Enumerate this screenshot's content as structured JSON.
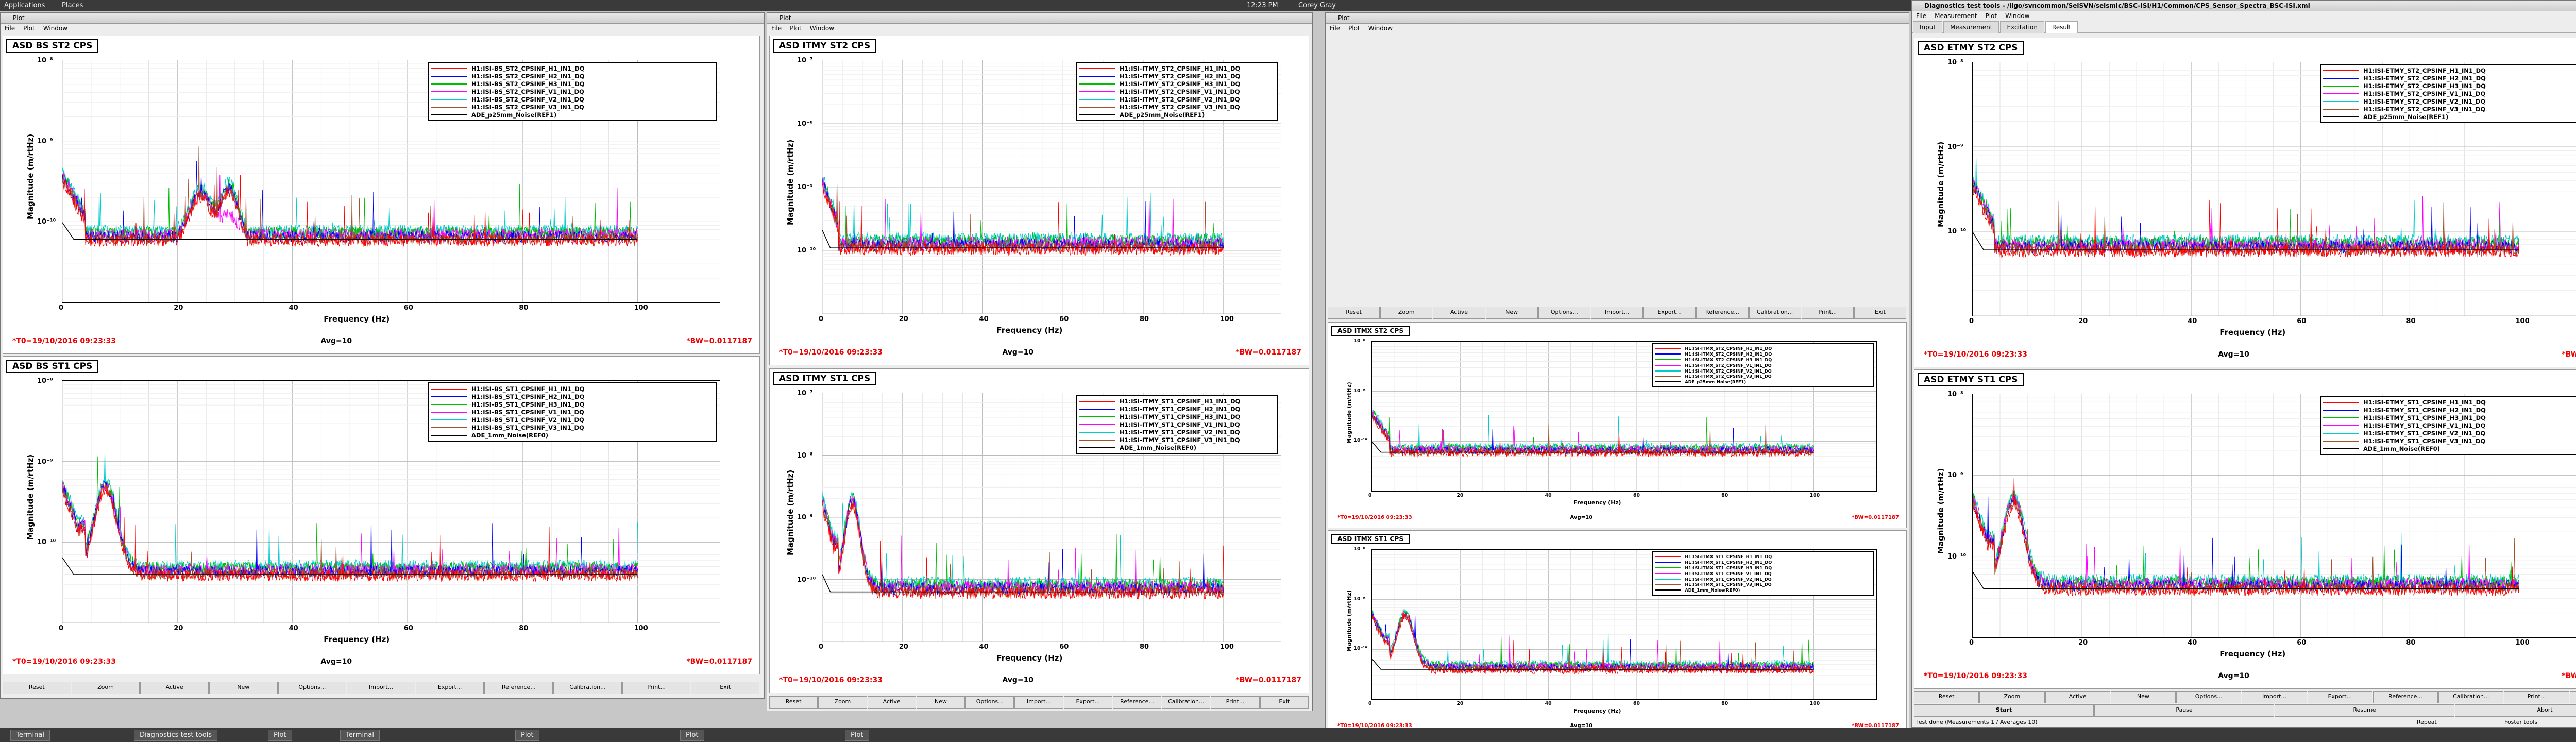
{
  "topbar": {
    "applications": "Applications",
    "places": "Places",
    "clock": "12:23 PM",
    "user": "Corey Gray"
  },
  "taskbar": {
    "tasks": [
      "Terminal",
      "Diagnostics test tools",
      "Plot",
      "Terminal",
      "Plot",
      "Plot",
      "Plot"
    ]
  },
  "windows": {
    "plot1": {
      "title": "Plot",
      "menus": [
        "File",
        "Plot",
        "Window"
      ]
    },
    "plot2": {
      "title": "Plot",
      "menus": [
        "File",
        "Plot",
        "Window"
      ]
    },
    "plot3": {
      "title": "Plot",
      "menus": [
        "File",
        "Plot",
        "Window"
      ]
    },
    "diag": {
      "title": "Diagnostics test tools - /ligo/svncommon/SeiSVN/seismic/BSC-ISI/H1/Common/CPS_Sensor_Spectra_BSC-ISI.xml",
      "menus": [
        "File",
        "Measurement",
        "Plot",
        "Window"
      ],
      "tabs": [
        "Input",
        "Measurement",
        "Excitation",
        "Result"
      ],
      "start": "Start",
      "pause": "Pause",
      "resume": "Resume",
      "abort": "Abort",
      "status_left": "Test done (Measurements 1 / Averages 10)",
      "status_mid": "Repeat",
      "status_right": "Foster tools"
    }
  },
  "buttons": [
    "Reset",
    "Zoom",
    "Active",
    "New",
    "Options...",
    "Import...",
    "Export...",
    "Reference...",
    "Calibration...",
    "Print...",
    "Exit"
  ],
  "common": {
    "ylabel": "Magnitude (m/rtHz)",
    "xlabel": "Frequency (Hz)",
    "t0": "*T0=19/10/2016 09:23:33",
    "avg": "Avg=10",
    "bw": "*BW=0.0117187",
    "xticks": [
      "0",
      "20",
      "40",
      "60",
      "80",
      "100"
    ],
    "yticks3": [
      "10⁻⁸",
      "10⁻⁹",
      "10⁻¹⁰"
    ],
    "yticks2": [
      "10⁻⁹",
      "10⁻¹⁰"
    ],
    "yticks4": [
      "10⁻⁷",
      "10⁻⁸",
      "10⁻⁹",
      "10⁻¹⁰"
    ]
  },
  "colors": {
    "H1": "#ff0000",
    "H2": "#0000ff",
    "H3": "#00bb00",
    "V1": "#ff00ff",
    "V2": "#00cccc",
    "V3": "#a0522d",
    "REF": "#000000"
  },
  "panels": [
    {
      "title": "ASD BS ST2 CPS",
      "legend": [
        "H1:ISI-BS_ST2_CPSINF_H1_IN1_DQ",
        "H1:ISI-BS_ST2_CPSINF_H2_IN1_DQ",
        "H1:ISI-BS_ST2_CPSINF_H3_IN1_DQ",
        "H1:ISI-BS_ST2_CPSINF_V1_IN1_DQ",
        "H1:ISI-BS_ST2_CPSINF_V2_IN1_DQ",
        "H1:ISI-BS_ST2_CPSINF_V3_IN1_DQ",
        "ADE_p25mm_Noise(REF1)"
      ]
    },
    {
      "title": "ASD BS ST1 CPS",
      "legend": [
        "H1:ISI-BS_ST1_CPSINF_H1_IN1_DQ",
        "H1:ISI-BS_ST1_CPSINF_H2_IN1_DQ",
        "H1:ISI-BS_ST1_CPSINF_H3_IN1_DQ",
        "H1:ISI-BS_ST1_CPSINF_V1_IN1_DQ",
        "H1:ISI-BS_ST1_CPSINF_V2_IN1_DQ",
        "H1:ISI-BS_ST1_CPSINF_V3_IN1_DQ",
        "ADE_1mm_Noise(REF0)"
      ]
    },
    {
      "title": "ASD ITMY ST2 CPS",
      "legend": [
        "H1:ISI-ITMY_ST2_CPSINF_H1_IN1_DQ",
        "H1:ISI-ITMY_ST2_CPSINF_H2_IN1_DQ",
        "H1:ISI-ITMY_ST2_CPSINF_H3_IN1_DQ",
        "H1:ISI-ITMY_ST2_CPSINF_V1_IN1_DQ",
        "H1:ISI-ITMY_ST2_CPSINF_V2_IN1_DQ",
        "H1:ISI-ITMY_ST2_CPSINF_V3_IN1_DQ",
        "ADE_p25mm_Noise(REF1)"
      ]
    },
    {
      "title": "ASD ITMY ST1 CPS",
      "legend": [
        "H1:ISI-ITMY_ST1_CPSINF_H1_IN1_DQ",
        "H1:ISI-ITMY_ST1_CPSINF_H2_IN1_DQ",
        "H1:ISI-ITMY_ST1_CPSINF_H3_IN1_DQ",
        "H1:ISI-ITMY_ST1_CPSINF_V1_IN1_DQ",
        "H1:ISI-ITMY_ST1_CPSINF_V2_IN1_DQ",
        "H1:ISI-ITMY_ST1_CPSINF_V3_IN1_DQ",
        "ADE_1mm_Noise(REF0)"
      ]
    },
    {
      "title": "ASD ITMX ST2 CPS",
      "legend": [
        "H1:ISI-ITMX_ST2_CPSINF_H1_IN1_DQ",
        "H1:ISI-ITMX_ST2_CPSINF_H2_IN1_DQ",
        "H1:ISI-ITMX_ST2_CPSINF_H3_IN1_DQ",
        "H1:ISI-ITMX_ST2_CPSINF_V1_IN1_DQ",
        "H1:ISI-ITMX_ST2_CPSINF_V2_IN1_DQ",
        "H1:ISI-ITMX_ST2_CPSINF_V3_IN1_DQ",
        "ADE_p25mm_Noise(REF1)"
      ]
    },
    {
      "title": "ASD ITMX ST1 CPS",
      "legend": [
        "H1:ISI-ITMX_ST1_CPSINF_H1_IN1_DQ",
        "H1:ISI-ITMX_ST1_CPSINF_H2_IN1_DQ",
        "H1:ISI-ITMX_ST1_CPSINF_H3_IN1_DQ",
        "H1:ISI-ITMX_ST1_CPSINF_V1_IN1_DQ",
        "H1:ISI-ITMX_ST1_CPSINF_V2_IN1_DQ",
        "H1:ISI-ITMX_ST1_CPSINF_V3_IN1_DQ",
        "ADE_1mm_Noise(REF0)"
      ]
    },
    {
      "title": "ASD ETMY ST2 CPS",
      "legend": [
        "H1:ISI-ETMY_ST2_CPSINF_H1_IN1_DQ",
        "H1:ISI-ETMY_ST2_CPSINF_H2_IN1_DQ",
        "H1:ISI-ETMY_ST2_CPSINF_H3_IN1_DQ",
        "H1:ISI-ETMY_ST2_CPSINF_V1_IN1_DQ",
        "H1:ISI-ETMY_ST2_CPSINF_V2_IN1_DQ",
        "H1:ISI-ETMY_ST2_CPSINF_V3_IN1_DQ",
        "ADE_p25mm_Noise(REF1)"
      ]
    },
    {
      "title": "ASD ETMY ST1 CPS",
      "legend": [
        "H1:ISI-ETMY_ST1_CPSINF_H1_IN1_DQ",
        "H1:ISI-ETMY_ST1_CPSINF_H2_IN1_DQ",
        "H1:ISI-ETMY_ST1_CPSINF_H3_IN1_DQ",
        "H1:ISI-ETMY_ST1_CPSINF_V1_IN1_DQ",
        "H1:ISI-ETMY_ST1_CPSINF_V2_IN1_DQ",
        "H1:ISI-ETMY_ST1_CPSINF_V3_IN1_DQ",
        "ADE_1mm_Noise(REF0)"
      ]
    }
  ],
  "chart_data": [
    {
      "type": "line",
      "title": "ASD BS ST2 CPS",
      "xlabel": "Frequency (Hz)",
      "ylabel": "Magnitude (m/rtHz)",
      "xlim": [
        0,
        100
      ],
      "yscale": "log",
      "ylim": [
        3e-11,
        1e-08
      ],
      "grid": true,
      "legend_position": "top-right"
    },
    {
      "type": "line",
      "title": "ASD BS ST1 CPS",
      "xlabel": "Frequency (Hz)",
      "ylabel": "Magnitude (m/rtHz)",
      "xlim": [
        0,
        100
      ],
      "yscale": "log",
      "ylim": [
        6e-11,
        1e-08
      ],
      "grid": true,
      "legend_position": "top-right"
    },
    {
      "type": "line",
      "title": "ASD ITMY ST2 CPS",
      "xlabel": "Frequency (Hz)",
      "ylabel": "Magnitude (m/rtHz)",
      "xlim": [
        0,
        100
      ],
      "yscale": "log",
      "ylim": [
        1e-11,
        1e-07
      ],
      "grid": true,
      "legend_position": "top-right"
    },
    {
      "type": "line",
      "title": "ASD ITMY ST1 CPS",
      "xlabel": "Frequency (Hz)",
      "ylabel": "Magnitude (m/rtHz)",
      "xlim": [
        0,
        100
      ],
      "yscale": "log",
      "ylim": [
        6e-11,
        1e-07
      ],
      "grid": true,
      "legend_position": "top-right"
    },
    {
      "type": "line",
      "title": "ASD ITMX ST2 CPS",
      "xlabel": "Frequency (Hz)",
      "ylabel": "Magnitude (m/rtHz)",
      "xlim": [
        0,
        100
      ],
      "yscale": "log",
      "grid": true,
      "legend_position": "top-right"
    },
    {
      "type": "line",
      "title": "ASD ITMX ST1 CPS",
      "xlabel": "Frequency (Hz)",
      "ylabel": "Magnitude (m/rtHz)",
      "xlim": [
        0,
        100
      ],
      "yscale": "log",
      "grid": true,
      "legend_position": "top-right"
    },
    {
      "type": "line",
      "title": "ASD ETMY ST2 CPS",
      "xlabel": "Frequency (Hz)",
      "ylabel": "Magnitude (m/rtHz)",
      "xlim": [
        0,
        100
      ],
      "yscale": "log",
      "ylim": [
        3e-11,
        1e-08
      ],
      "grid": true,
      "legend_position": "top-right"
    },
    {
      "type": "line",
      "title": "ASD ETMY ST1 CPS",
      "xlabel": "Frequency (Hz)",
      "ylabel": "Magnitude (m/rtHz)",
      "xlim": [
        0,
        100
      ],
      "yscale": "log",
      "ylim": [
        5e-11,
        1e-08
      ],
      "grid": true,
      "legend_position": "top-right"
    }
  ]
}
